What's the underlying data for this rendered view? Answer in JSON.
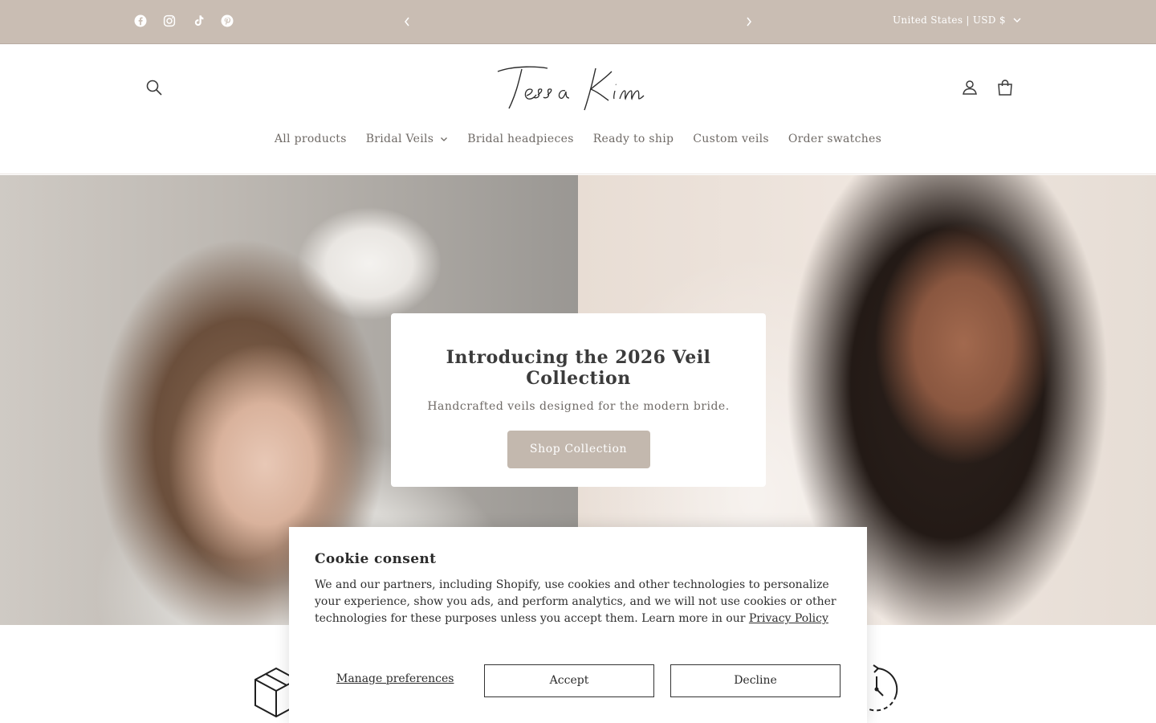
{
  "announcement": {
    "social": [
      "facebook-icon",
      "instagram-icon",
      "tiktok-icon",
      "pinterest-icon"
    ],
    "locale_label": "United States | USD $"
  },
  "header": {
    "logo_text": "Tessa Kim",
    "nav": [
      {
        "label": "All products"
      },
      {
        "label": "Bridal Veils",
        "has_dropdown": true
      },
      {
        "label": "Bridal headpieces"
      },
      {
        "label": "Ready to ship"
      },
      {
        "label": "Custom veils"
      },
      {
        "label": "Order swatches"
      }
    ]
  },
  "hero": {
    "title": "Introducing the 2026 Veil Collection",
    "subtitle": "Handcrafted veils designed for the modern bride.",
    "button_label": "Shop Collection"
  },
  "cookie": {
    "title": "Cookie consent",
    "text": "We and our partners, including Shopify, use cookies and other technologies to personalize your experience, show you ads, and perform analytics, and we will not use cookies or other technologies for these purposes unless you accept them. Learn more in our ",
    "link_label": "Privacy Policy",
    "manage_label": "Manage preferences",
    "accept_label": "Accept",
    "decline_label": "Decline"
  },
  "colors": {
    "announcement_bg": "#c9bdb3",
    "button_bg": "#c3b8ae"
  }
}
